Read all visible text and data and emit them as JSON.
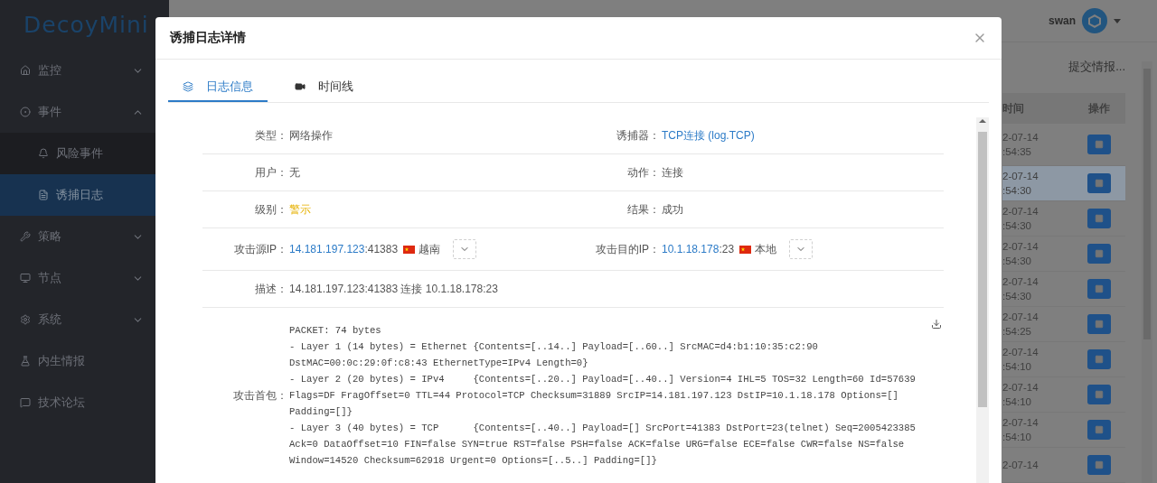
{
  "logo": "DecoyMini",
  "sidebar": {
    "items": [
      {
        "label": "监控",
        "kind": "group",
        "expanded": false
      },
      {
        "label": "事件",
        "kind": "group",
        "expanded": true
      },
      {
        "label": "风险事件",
        "kind": "child",
        "selected": false
      },
      {
        "label": "诱捕日志",
        "kind": "child",
        "selected": true
      },
      {
        "label": "策略",
        "kind": "group",
        "expanded": false
      },
      {
        "label": "节点",
        "kind": "group",
        "expanded": false
      },
      {
        "label": "系统",
        "kind": "group",
        "expanded": false
      },
      {
        "label": "内生情报",
        "kind": "link"
      },
      {
        "label": "技术论坛",
        "kind": "link"
      }
    ]
  },
  "header": {
    "user": "swan"
  },
  "toolbar": {
    "submit": "提交情报..."
  },
  "table": {
    "columns": [
      "时间",
      "操作"
    ],
    "rows": [
      {
        "date": "2-07-14",
        "time": ":54:35",
        "selected": false
      },
      {
        "date": "2-07-14",
        "time": ":54:30",
        "selected": true
      },
      {
        "date": "2-07-14",
        "time": ":54:30",
        "selected": false
      },
      {
        "date": "2-07-14",
        "time": ":54:30",
        "selected": false
      },
      {
        "date": "2-07-14",
        "time": ":54:30",
        "selected": false
      },
      {
        "date": "2-07-14",
        "time": ":54:25",
        "selected": false
      },
      {
        "date": "2-07-14",
        "time": ":54:10",
        "selected": false
      },
      {
        "date": "2-07-14",
        "time": ":54:10",
        "selected": false
      },
      {
        "date": "2-07-14",
        "time": ":54:10",
        "selected": false
      },
      {
        "date": "2-07-14",
        "selected": false
      }
    ]
  },
  "dialog": {
    "title": "诱捕日志详情",
    "tabs": [
      {
        "label": "日志信息",
        "selected": true
      },
      {
        "label": "时间线",
        "selected": false
      }
    ],
    "rows": [
      {
        "kind": "pair",
        "fields": [
          {
            "label": "类型：",
            "value": "网络操作",
            "kind": "plain"
          },
          {
            "label": "诱捕器：",
            "value": "TCP连接 (log.TCP)",
            "kind": "link"
          }
        ]
      },
      {
        "kind": "pair",
        "fields": [
          {
            "label": "用户：",
            "value": "无",
            "kind": "plain"
          },
          {
            "label": "动作：",
            "value": "连接",
            "kind": "plain"
          }
        ]
      },
      {
        "kind": "pair",
        "fields": [
          {
            "label": "级别：",
            "value": "警示",
            "kind": "warning"
          },
          {
            "label": "结果：",
            "value": "成功",
            "kind": "plain"
          }
        ]
      },
      {
        "kind": "ip",
        "fields": [
          {
            "label": "攻击源IP：",
            "ip": "14.181.197.123",
            "port": ":41383",
            "country": "越南"
          },
          {
            "label": "攻击目的IP：",
            "ip": "10.1.18.178",
            "port": ":23",
            "country": "本地"
          }
        ]
      },
      {
        "kind": "text",
        "label": "描述：",
        "value": "14.181.197.123:41383 连接 10.1.18.178:23"
      },
      {
        "kind": "packet",
        "label": "攻击首包：",
        "lines": [
          "PACKET: 74 bytes",
          "- Layer 1 (14 bytes) = Ethernet {Contents=[..14..] Payload=[..60..] SrcMAC=d4:b1:10:35:c2:90",
          "DstMAC=00:0c:29:0f:c8:43 EthernetType=IPv4 Length=0}",
          "- Layer 2 (20 bytes) = IPv4     {Contents=[..20..] Payload=[..40..] Version=4 IHL=5 TOS=32 Length=60 Id=57639",
          "Flags=DF FragOffset=0 TTL=44 Protocol=TCP Checksum=31889 SrcIP=14.181.197.123 DstIP=10.1.18.178 Options=[]",
          "Padding=[]}",
          "- Layer 3 (40 bytes) = TCP      {Contents=[..40..] Payload=[] SrcPort=41383 DstPort=23(telnet) Seq=2005423385",
          "Ack=0 DataOffset=10 FIN=false SYN=true RST=false PSH=false ACK=false URG=false ECE=false CWR=false NS=false",
          "Window=14520 Checksum=62918 Urgent=0 Options=[..5..] Padding=[]}"
        ]
      }
    ]
  }
}
